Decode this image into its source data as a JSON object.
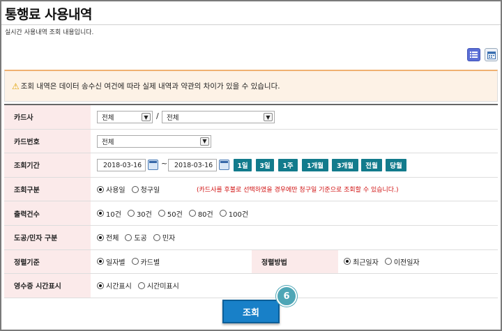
{
  "header": {
    "title": "통행료 사용내역",
    "subtitle": "실시간 사용내역 조회 내용입니다."
  },
  "view_toggle": {
    "list_icon": "list-icon",
    "calendar_icon": "calendar-icon"
  },
  "notice": {
    "icon": "warning-icon",
    "text": "조회 내역은 데이터 송수신 여건에 따라 실제 내역과 약관의 차이가 있을 수 있습니다."
  },
  "form": {
    "card_company": {
      "label": "카드사",
      "select1": "전체",
      "separator": "/",
      "select2": "전체"
    },
    "card_number": {
      "label": "카드번호",
      "select": "전체"
    },
    "period": {
      "label": "조회기간",
      "start": "2018-03-16",
      "tilde": "~",
      "end": "2018-03-16",
      "presets": [
        "1일",
        "3일",
        "1주",
        "1개월",
        "3개월",
        "전월",
        "당월"
      ]
    },
    "query_type": {
      "label": "조회구분",
      "options": [
        "사용일",
        "청구일"
      ],
      "selected": "사용일",
      "note": "(카드사를 후불로 선택하였을 경우에만 청구일 기준으로 조회할 수 있습니다.)"
    },
    "output_count": {
      "label": "출력건수",
      "options": [
        "10건",
        "30건",
        "50건",
        "80건",
        "100건"
      ],
      "selected": "10건"
    },
    "road_type": {
      "label": "도공/민자 구분",
      "options": [
        "전체",
        "도공",
        "민자"
      ],
      "selected": "전체"
    },
    "sort_basis": {
      "label": "정렬기준",
      "options": [
        "일자별",
        "카드별"
      ],
      "selected": "일자별"
    },
    "sort_order": {
      "label": "정렬방법",
      "options": [
        "최근일자",
        "이전일자"
      ],
      "selected": "최근일자"
    },
    "receipt_time": {
      "label": "영수증 시간표시",
      "options": [
        "시간표시",
        "시간미표시"
      ],
      "selected": "시간표시"
    }
  },
  "search_button": "조회",
  "step_marker": "6"
}
